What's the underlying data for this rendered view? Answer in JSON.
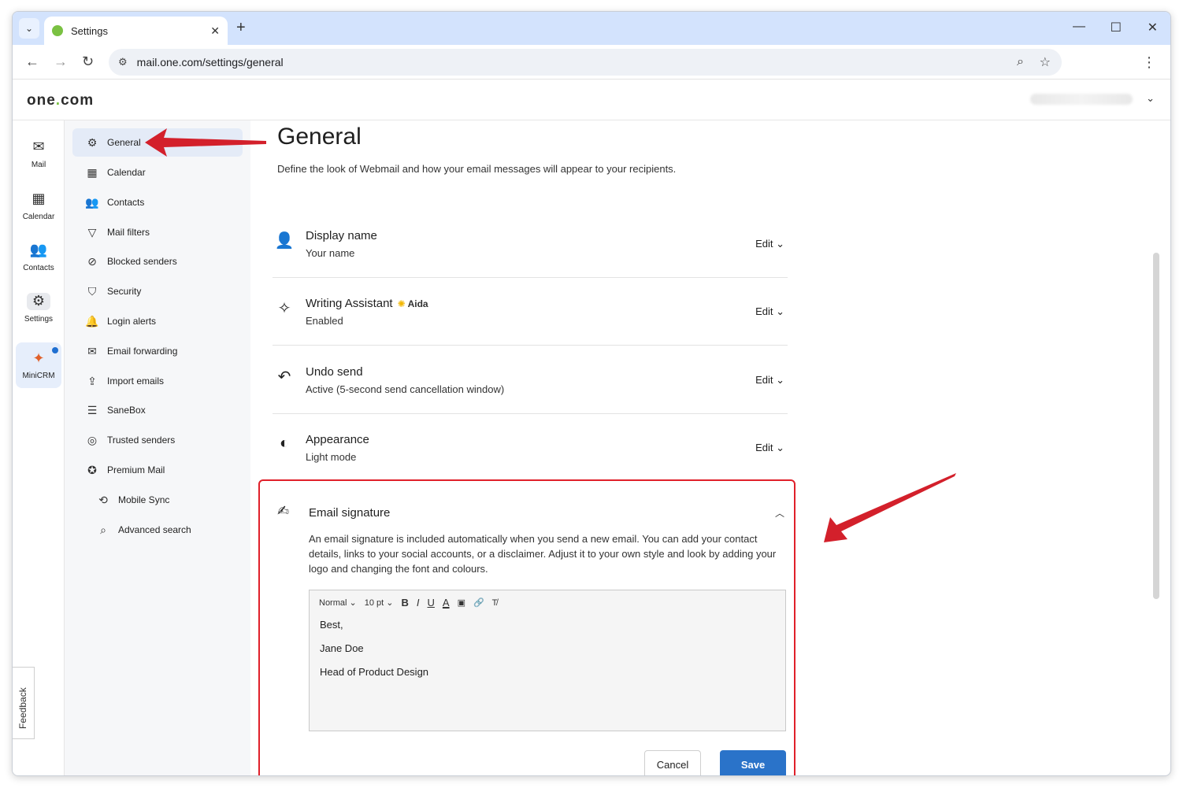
{
  "browser": {
    "tab_title": "Settings",
    "url": "mail.one.com/settings/general"
  },
  "app": {
    "logo_text": "one",
    "logo_dot": ".",
    "logo_suffix": "com"
  },
  "rail": {
    "items": [
      {
        "label": "Mail",
        "icon": "mail-icon"
      },
      {
        "label": "Calendar",
        "icon": "calendar-icon"
      },
      {
        "label": "Contacts",
        "icon": "contacts-icon"
      },
      {
        "label": "Settings",
        "icon": "gear-icon"
      },
      {
        "label": "MiniCRM",
        "icon": "minicrm-icon"
      }
    ],
    "feedback": "Feedback"
  },
  "settings_nav": {
    "items": [
      {
        "label": "General",
        "icon": "gear-icon"
      },
      {
        "label": "Calendar",
        "icon": "calendar-icon"
      },
      {
        "label": "Contacts",
        "icon": "contacts-icon"
      },
      {
        "label": "Mail filters",
        "icon": "filter-icon"
      },
      {
        "label": "Blocked senders",
        "icon": "block-icon"
      },
      {
        "label": "Security",
        "icon": "shield-icon"
      },
      {
        "label": "Login alerts",
        "icon": "bell-icon"
      },
      {
        "label": "Email forwarding",
        "icon": "forward-mail-icon"
      },
      {
        "label": "Import emails",
        "icon": "import-icon"
      },
      {
        "label": "SaneBox",
        "icon": "sanebox-icon"
      },
      {
        "label": "Trusted senders",
        "icon": "trusted-icon"
      },
      {
        "label": "Premium Mail",
        "icon": "premium-icon"
      },
      {
        "label": "Mobile Sync",
        "icon": "sync-icon"
      },
      {
        "label": "Advanced search",
        "icon": "search-icon"
      }
    ]
  },
  "main": {
    "title": "General",
    "description": "Define the look of Webmail and how your email messages will appear to your recipients.",
    "edit_label": "Edit",
    "rows": [
      {
        "name": "Display name",
        "value": "Your name",
        "icon": "person-icon"
      },
      {
        "name": "Writing Assistant",
        "badge": "Aida",
        "value": "Enabled",
        "icon": "sparkle-icon"
      },
      {
        "name": "Undo send",
        "value": "Active (5-second send cancellation window)",
        "icon": "undo-icon"
      },
      {
        "name": "Appearance",
        "value": "Light mode",
        "icon": "contrast-icon"
      }
    ],
    "signature": {
      "title": "Email signature",
      "description": "An email signature is included automatically when you send a new email. You can add your contact details, links to your social accounts, or a disclaimer. Adjust it to your own style and look by adding your logo and changing the font and colours.",
      "toolbar": {
        "style": "Normal",
        "size": "10 pt",
        "bold": "B",
        "italic": "I",
        "underline": "U",
        "color": "A"
      },
      "lines": [
        "Best,",
        "Jane Doe",
        "Head of Product Design"
      ],
      "cancel_label": "Cancel",
      "save_label": "Save"
    }
  },
  "colors": {
    "accent": "#2a73c9",
    "highlight_border": "#e0202a",
    "brand_green": "#7ac142"
  }
}
